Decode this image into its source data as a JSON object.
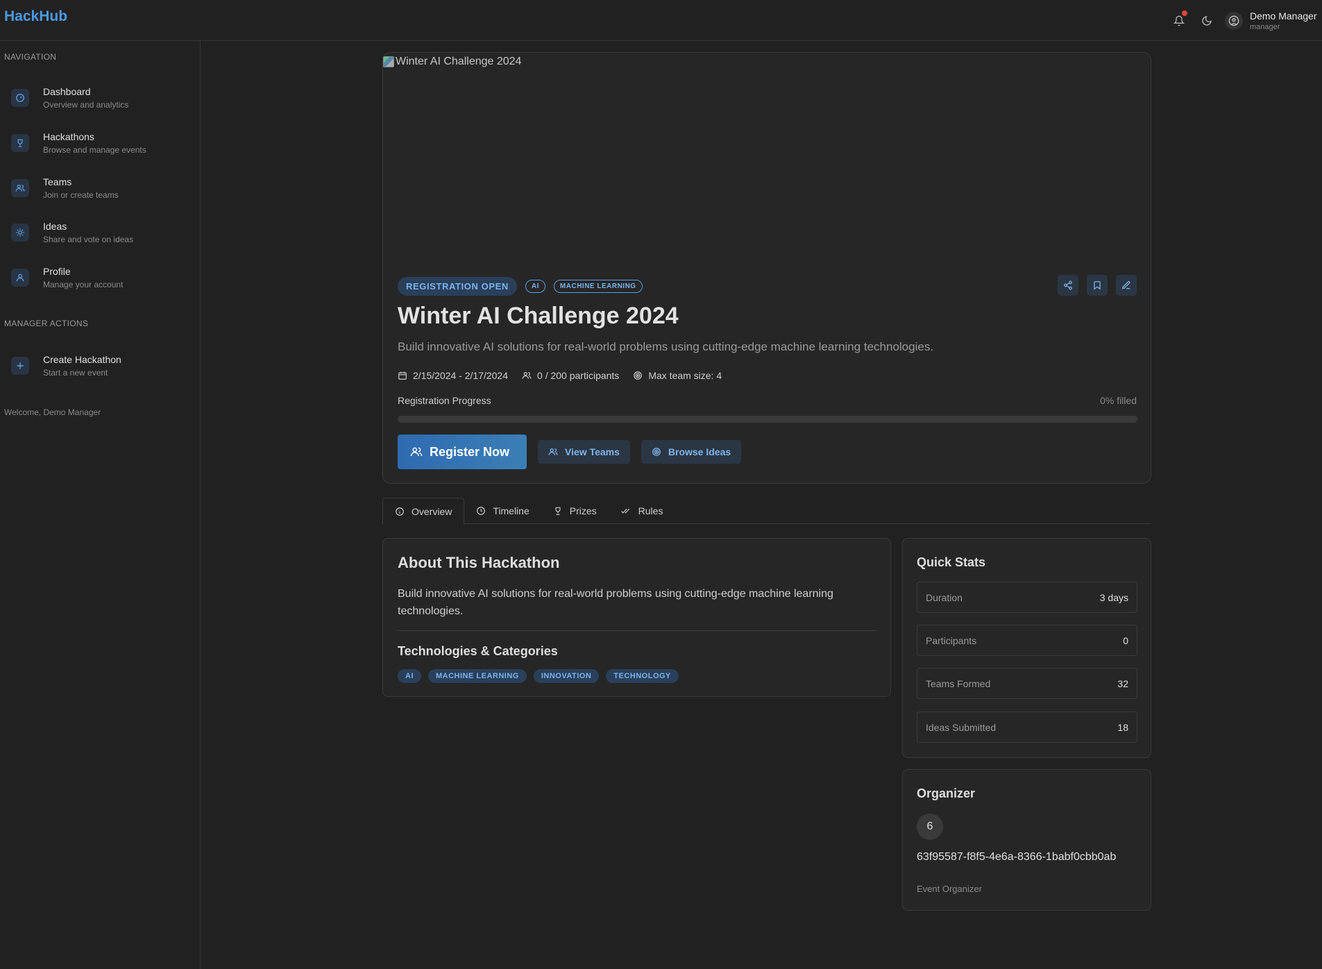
{
  "app": {
    "brand": "HackHub"
  },
  "header": {
    "user_name": "Demo Manager",
    "user_role": "manager",
    "icons": [
      "bell-icon",
      "moon-icon",
      "user-circle-icon"
    ]
  },
  "sidebar": {
    "nav_title": "NAVIGATION",
    "items": [
      {
        "label": "Dashboard",
        "sub": "Overview and analytics",
        "icon": "gauge-icon"
      },
      {
        "label": "Hackathons",
        "sub": "Browse and manage events",
        "icon": "trophy-icon"
      },
      {
        "label": "Teams",
        "sub": "Join or create teams",
        "icon": "users-icon"
      },
      {
        "label": "Ideas",
        "sub": "Share and vote on ideas",
        "icon": "lightbulb-icon"
      },
      {
        "label": "Profile",
        "sub": "Manage your account",
        "icon": "user-icon"
      }
    ],
    "manager_title": "MANAGER ACTIONS",
    "manager_items": [
      {
        "label": "Create Hackathon",
        "sub": "Start a new event",
        "icon": "plus-icon"
      }
    ],
    "welcome": "Welcome, Demo Manager"
  },
  "hero": {
    "image_alt": "Winter AI Challenge 2024",
    "status_badge": "REGISTRATION OPEN",
    "tags": [
      "AI",
      "MACHINE LEARNING"
    ],
    "title": "Winter AI Challenge 2024",
    "description": "Build innovative AI solutions for real-world problems using cutting-edge machine learning technologies.",
    "dates": "2/15/2024 - 2/17/2024",
    "participants": "0 / 200 participants",
    "team_size": "Max team size: 4",
    "progress_label": "Registration Progress",
    "progress_text": "0% filled",
    "progress_value": 0,
    "buttons": {
      "register": "Register Now",
      "view_teams": "View Teams",
      "browse_ideas": "Browse Ideas"
    }
  },
  "tabs": [
    {
      "label": "Overview",
      "icon": "info-icon",
      "active": true
    },
    {
      "label": "Timeline",
      "icon": "clock-icon",
      "active": false
    },
    {
      "label": "Prizes",
      "icon": "trophy-icon",
      "active": false
    },
    {
      "label": "Rules",
      "icon": "check-double-icon",
      "active": false
    }
  ],
  "about": {
    "title": "About This Hackathon",
    "text": "Build innovative AI solutions for real-world problems using cutting-edge machine learning technologies.",
    "tech_title": "Technologies & Categories",
    "tags": [
      "AI",
      "MACHINE LEARNING",
      "INNOVATION",
      "TECHNOLOGY"
    ]
  },
  "quick_stats": {
    "title": "Quick Stats",
    "rows": [
      {
        "label": "Duration",
        "value": "3 days"
      },
      {
        "label": "Participants",
        "value": "0"
      },
      {
        "label": "Teams Formed",
        "value": "32"
      },
      {
        "label": "Ideas Submitted",
        "value": "18"
      }
    ]
  },
  "organizer": {
    "title": "Organizer",
    "avatar": "6",
    "id": "63f95587-f8f5-4e6a-8366-1babf0cbb0ab",
    "role": "Event Organizer"
  },
  "colors": {
    "accent": "#4b9be6",
    "background": "#212121",
    "card": "#262626",
    "notification": "#e0443a"
  }
}
